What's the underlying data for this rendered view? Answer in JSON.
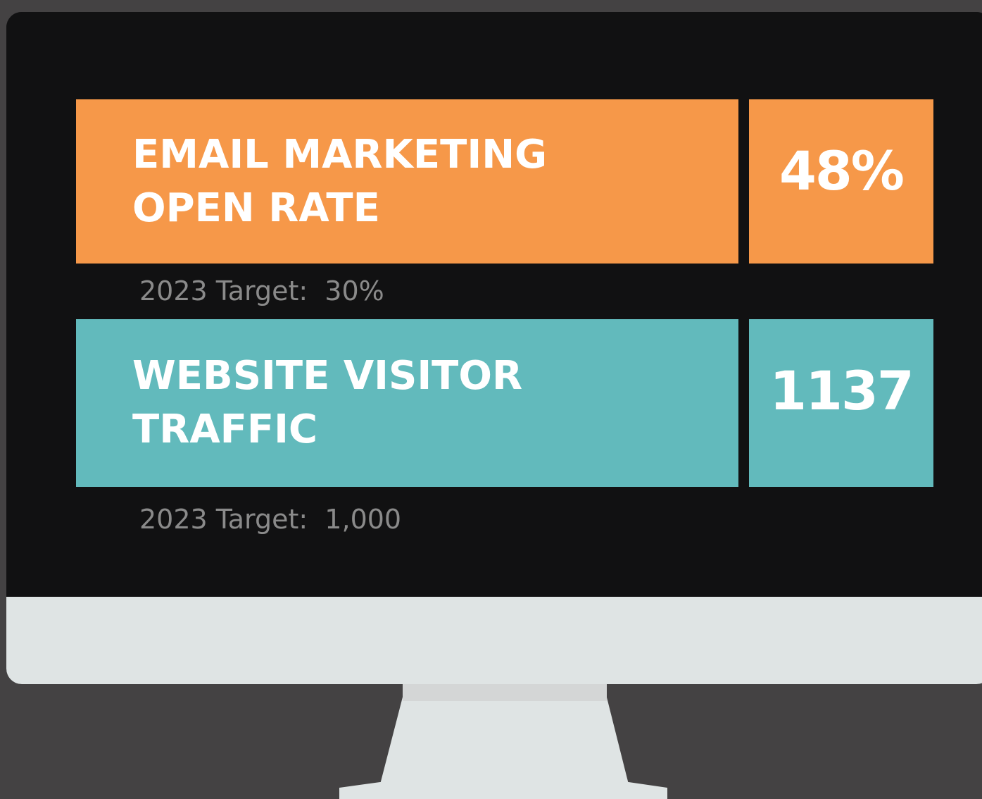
{
  "metrics": [
    {
      "label_line1": "EMAIL MARKETING",
      "label_line2": "OPEN RATE",
      "value": "48%",
      "target": "2023 Target:  30%",
      "color": "#f69849"
    },
    {
      "label_line1": "WEBSITE VISITOR",
      "label_line2": "TRAFFIC",
      "value": "1137",
      "target": "2023 Target:  1,000",
      "color": "#62babc"
    }
  ],
  "colors": {
    "background": "#444243",
    "screen": "#111112",
    "bezel": "#dfe4e4",
    "stand": "#dfe4e4",
    "target_text": "#8a8a8a"
  }
}
